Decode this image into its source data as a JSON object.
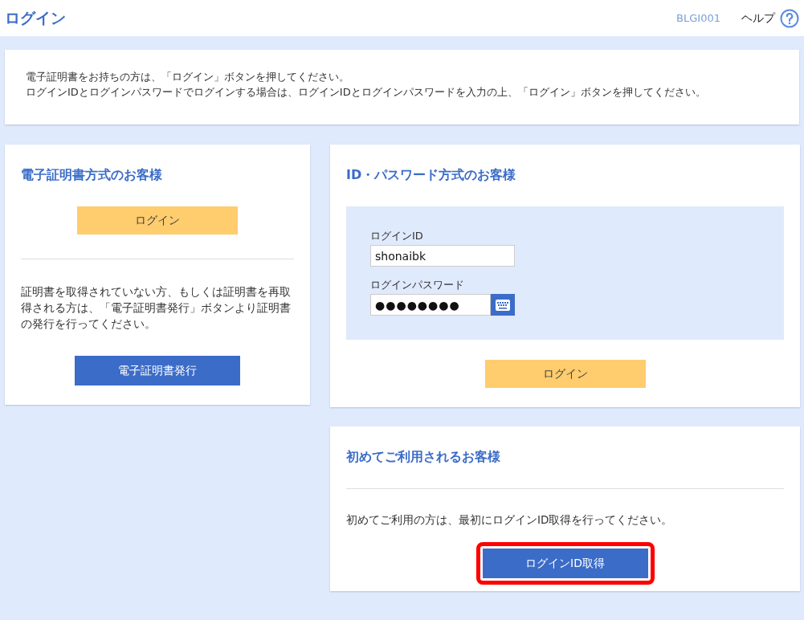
{
  "header": {
    "title": "ログイン",
    "screen_code": "BLGI001",
    "help_label": "ヘルプ"
  },
  "notice": [
    "電子証明書をお持ちの方は、「ログイン」ボタンを押してください。",
    "ログインIDとログインパスワードでログインする場合は、ログインIDとログインパスワードを入力の上、「ログイン」ボタンを押してください。"
  ],
  "certificate_panel": {
    "title": "電子証明書方式のお客様",
    "login_button": "ログイン",
    "description": "証明書を取得されていない方、もしくは証明書を再取得される方は、「電子証明書発行」ボタンより証明書の発行を行ってください。",
    "issue_button": "電子証明書発行"
  },
  "password_panel": {
    "title": "ID・パスワード方式のお客様",
    "id_label": "ログインID",
    "id_value": "shonaibk",
    "password_label": "ログインパスワード",
    "password_value": "●●●●●●●●",
    "login_button": "ログイン"
  },
  "first_time_panel": {
    "title": "初めてご利用されるお客様",
    "description": "初めてご利用の方は、最初にログインID取得を行ってください。",
    "button": "ログインID取得",
    "highlighted": true
  }
}
